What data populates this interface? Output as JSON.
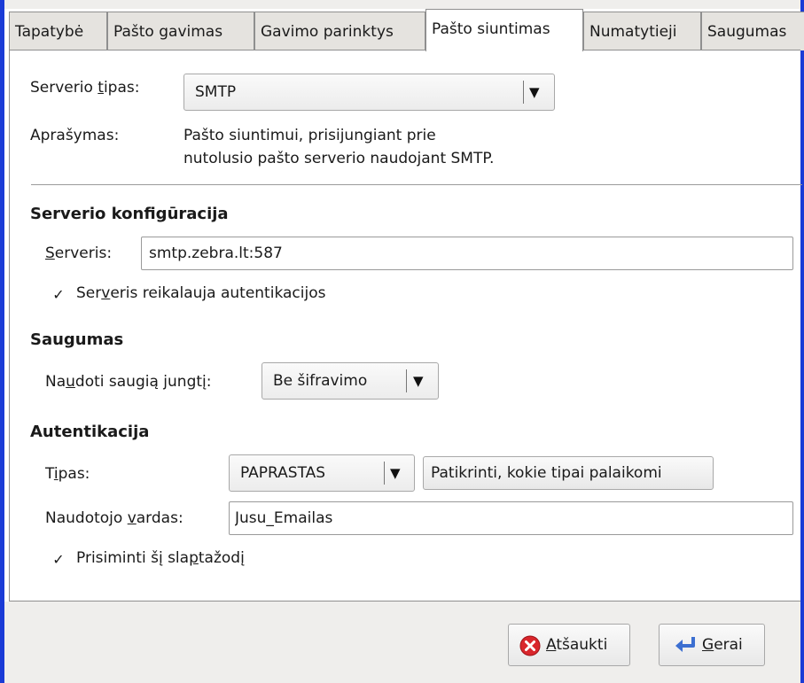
{
  "tabs": [
    {
      "label": "Tapatybė"
    },
    {
      "label": "Pašto gavimas"
    },
    {
      "label": "Gavimo parinktys"
    },
    {
      "label": "Pašto siuntimas"
    },
    {
      "label": "Numatytieji"
    },
    {
      "label": "Saugumas"
    }
  ],
  "active_tab": "Pašto siuntimas",
  "server_type": {
    "label_pre": "Serverio ",
    "label_u": "t",
    "label_post": "ipas:",
    "value": "SMTP"
  },
  "description": {
    "label": "Aprašymas:",
    "line1": "Pašto siuntimui, prisijungiant prie",
    "line2": "nutolusio pašto serverio naudojant SMTP."
  },
  "server_config": {
    "heading": "Serverio konfigūracija",
    "server_label_u": "S",
    "server_label_post": "erveris:",
    "server_value": "smtp.zebra.lt:587",
    "auth_pre": "Ser",
    "auth_u": "v",
    "auth_post": "eris reikalauja autentikacijos",
    "auth_checked": true
  },
  "security": {
    "heading": "Saugumas",
    "label_pre": "Na",
    "label_u": "u",
    "label_post": "doti saugią jungtį:",
    "value": "Be šifravimo"
  },
  "auth": {
    "heading": "Autentikacija",
    "type_label_pre": "T",
    "type_label_u": "i",
    "type_label_post": "pas:",
    "type_value": "PAPRASTAS",
    "check_button": "Patikrinti, kokie tipai palaikomi",
    "user_label_pre": "Naudotojo ",
    "user_label_u": "v",
    "user_label_post": "ardas:",
    "user_value": "Jusu_Emailas",
    "remember_pre": "Prisiminti šį sla",
    "remember_u": "p",
    "remember_post": "tažodį",
    "remember_checked": true
  },
  "buttons": {
    "cancel_u": "A",
    "cancel_post": "tšaukti",
    "ok_u": "G",
    "ok_post": "erai"
  },
  "icons": {
    "cancel": "cancel-circle-icon",
    "ok": "enter-arrow-icon",
    "dropdown": "chevron-down-icon",
    "check": "checkmark-icon"
  },
  "colors": {
    "window_border": "#1a3bd6",
    "cancel_icon": "#d9262c",
    "ok_icon": "#3c6fd1"
  }
}
